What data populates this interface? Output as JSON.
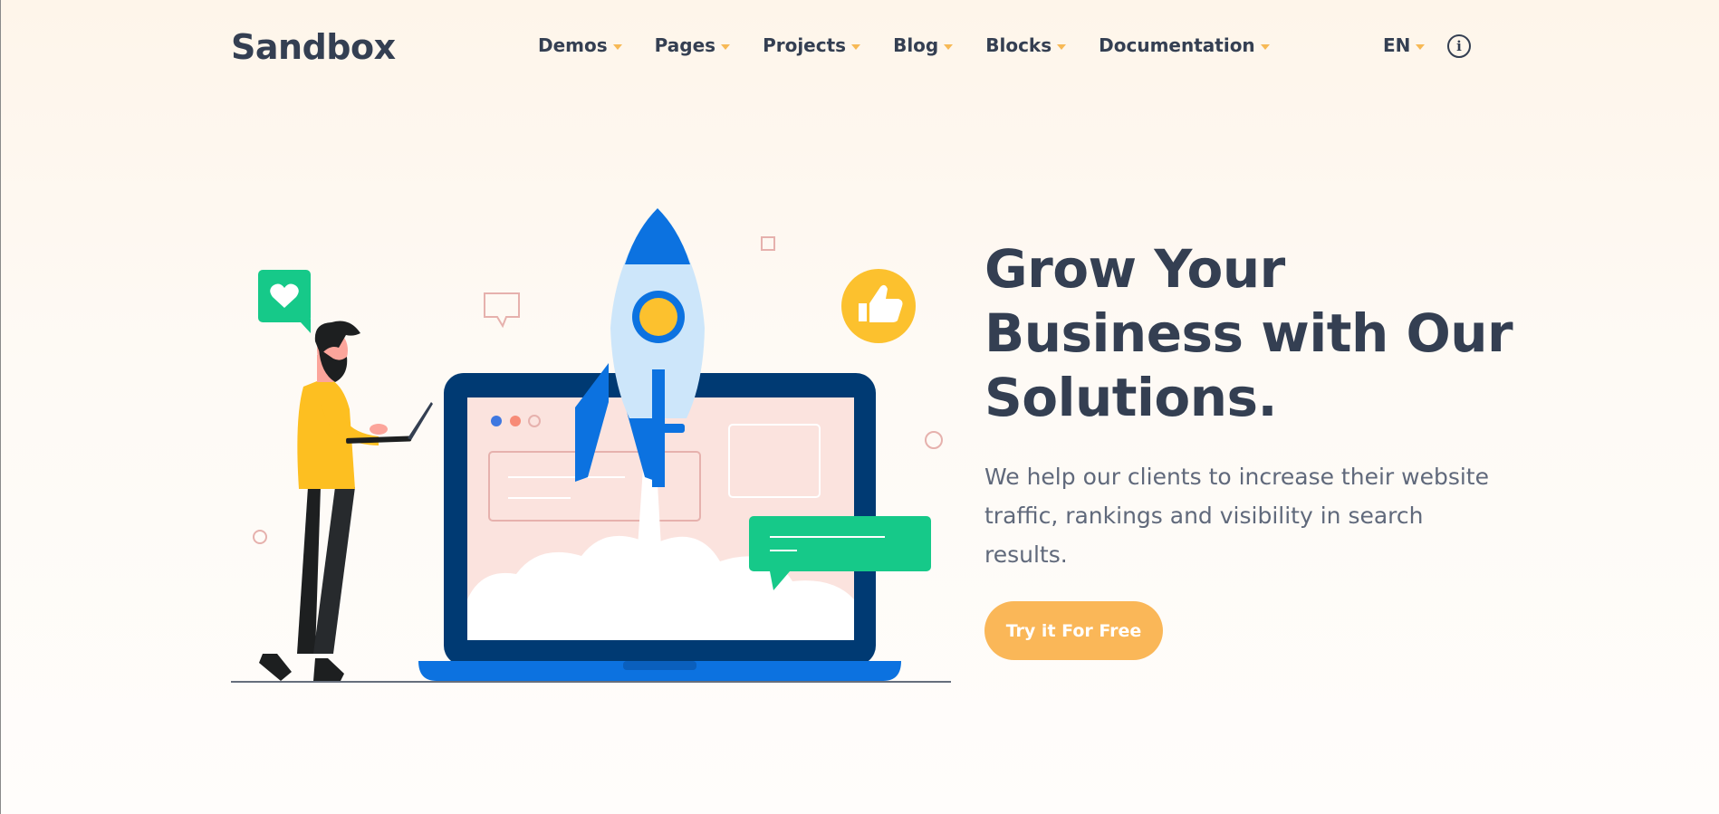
{
  "header": {
    "logo": "Sandbox",
    "nav": [
      {
        "label": "Demos"
      },
      {
        "label": "Pages"
      },
      {
        "label": "Projects"
      },
      {
        "label": "Blog"
      },
      {
        "label": "Blocks"
      },
      {
        "label": "Documentation"
      }
    ],
    "language": "EN",
    "info_icon": "info-circle-icon"
  },
  "hero": {
    "title_lines": [
      "Grow Your",
      "Business with Our",
      "Solutions."
    ],
    "text_lines": [
      "We help our clients to increase their website",
      "traffic, rankings and visibility in search",
      "results."
    ],
    "cta_label": "Try it For Free"
  },
  "colors": {
    "primary_text": "#343f52",
    "body_text": "#60697b",
    "accent": "#fab758",
    "blue": "#0c72e0",
    "green": "#16c989",
    "yellow": "#fcc12e"
  }
}
